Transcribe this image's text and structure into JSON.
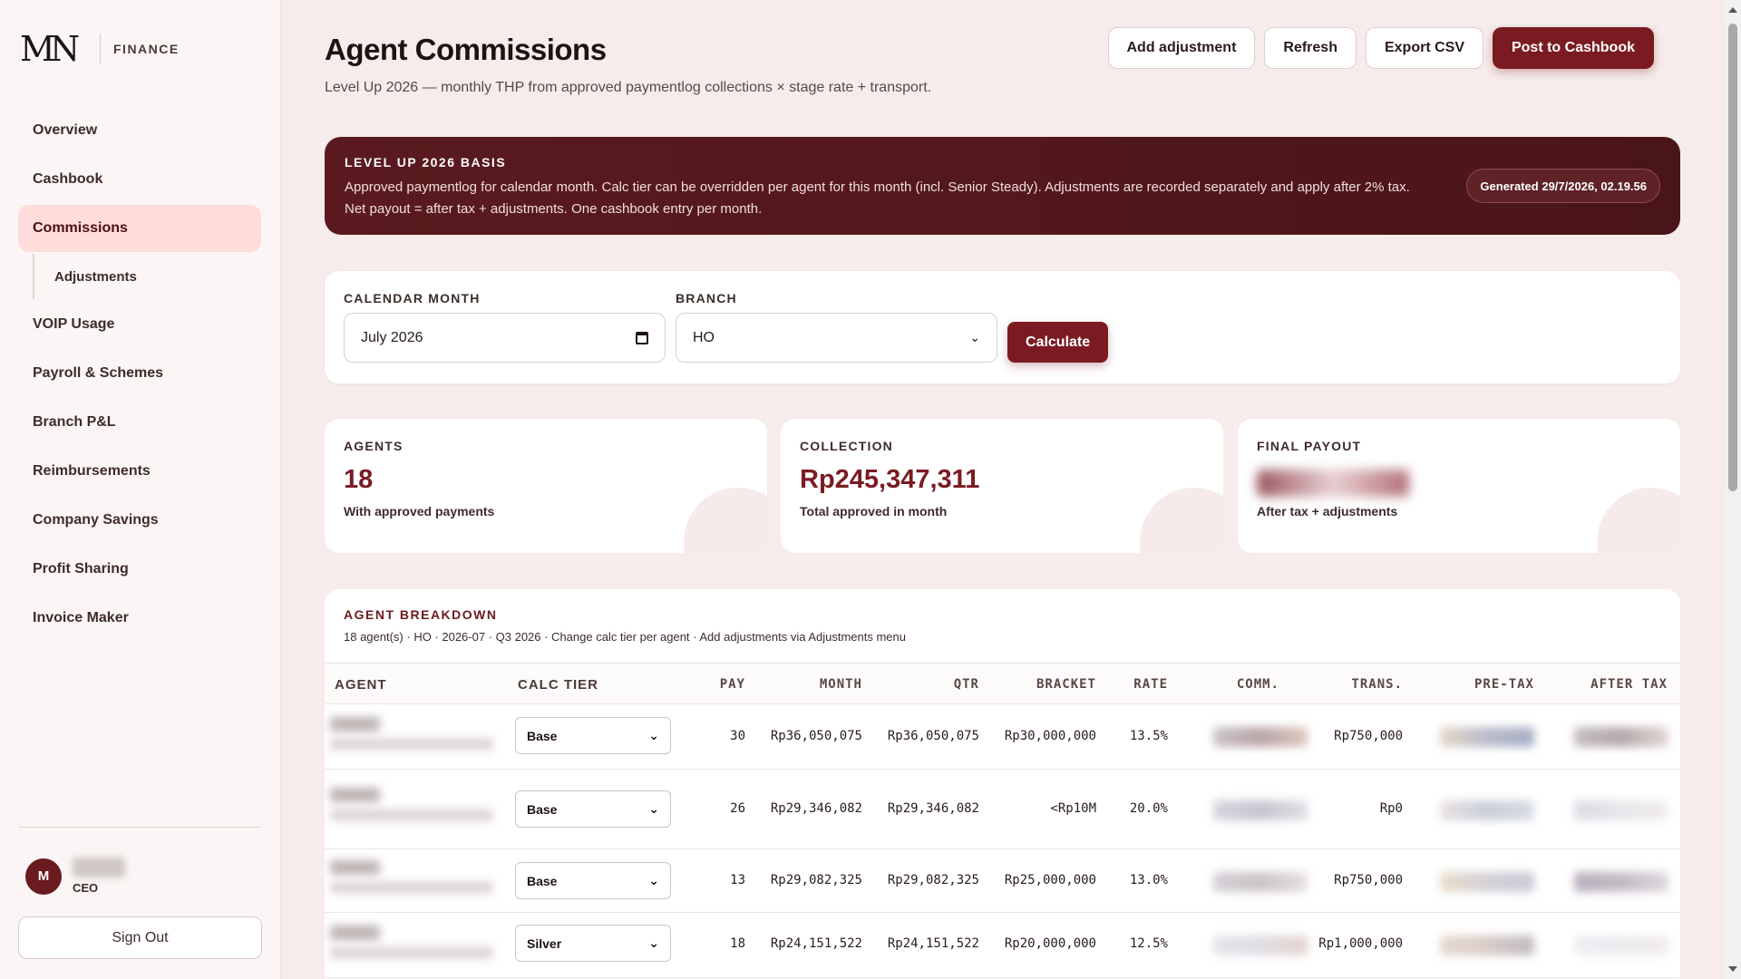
{
  "brand": {
    "logo": "MN",
    "label": "FINANCE"
  },
  "sidebar": {
    "items": [
      {
        "label": "Overview"
      },
      {
        "label": "Cashbook"
      },
      {
        "label": "Commissions"
      },
      {
        "label": "Adjustments"
      },
      {
        "label": "VOIP Usage"
      },
      {
        "label": "Payroll & Schemes"
      },
      {
        "label": "Branch P&L"
      },
      {
        "label": "Reimbursements"
      },
      {
        "label": "Company Savings"
      },
      {
        "label": "Profit Sharing"
      },
      {
        "label": "Invoice Maker"
      }
    ],
    "active": "Commissions",
    "user": {
      "initial": "M",
      "role": "CEO"
    },
    "signout": "Sign Out"
  },
  "header": {
    "title": "Agent Commissions",
    "subtitle": "Level Up 2026 — monthly THP from approved paymentlog collections × stage rate + transport.",
    "actions": {
      "add": "Add adjustment",
      "refresh": "Refresh",
      "export": "Export CSV",
      "post": "Post to Cashbook"
    }
  },
  "banner": {
    "title": "LEVEL UP 2026 BASIS",
    "text": "Approved paymentlog for calendar month. Calc tier can be overridden per agent for this month (incl. Senior Steady). Adjustments are recorded separately and apply after 2% tax. Net payout = after tax + adjustments. One cashbook entry per month.",
    "generated": "Generated 29/7/2026, 02.19.56"
  },
  "filters": {
    "month_label": "CALENDAR MONTH",
    "month_value": "July 2026",
    "branch_label": "BRANCH",
    "branch_value": "HO",
    "calculate": "Calculate"
  },
  "stats": {
    "agents": {
      "label": "AGENTS",
      "value": "18",
      "note": "With approved payments"
    },
    "collection": {
      "label": "COLLECTION",
      "value": "Rp245,347,311",
      "note": "Total approved in month"
    },
    "payout": {
      "label": "FINAL PAYOUT",
      "note": "After tax + adjustments"
    }
  },
  "table": {
    "title": "AGENT BREAKDOWN",
    "subtitle": "18 agent(s) · HO · 2026-07 · Q3 2026 · Change calc tier per agent · Add adjustments via Adjustments menu",
    "headers": {
      "agent": "AGENT",
      "tier": "CALC TIER",
      "pay": "PAY",
      "month": "MONTH",
      "qtr": "QTR",
      "bracket": "BRACKET",
      "rate": "RATE",
      "comm": "COMM.",
      "trans": "TRANS.",
      "pretax": "PRE-TAX",
      "aftertax": "AFTER TAX"
    },
    "rows": [
      {
        "tier": "Base",
        "pay": "30",
        "month": "Rp36,050,075",
        "qtr": "Rp36,050,075",
        "bracket": "Rp30,000,000",
        "rate": "13.5%",
        "trans": "Rp750,000"
      },
      {
        "tier": "Base",
        "pay": "26",
        "month": "Rp29,346,082",
        "qtr": "Rp29,346,082",
        "bracket": "<Rp10M",
        "rate": "20.0%",
        "trans": "Rp0"
      },
      {
        "tier": "Base",
        "pay": "13",
        "month": "Rp29,082,325",
        "qtr": "Rp29,082,325",
        "bracket": "Rp25,000,000",
        "rate": "13.0%",
        "trans": "Rp750,000"
      },
      {
        "tier": "Silver",
        "pay": "18",
        "month": "Rp24,151,522",
        "qtr": "Rp24,151,522",
        "bracket": "Rp20,000,000",
        "rate": "12.5%",
        "trans": "Rp1,000,000"
      }
    ]
  }
}
